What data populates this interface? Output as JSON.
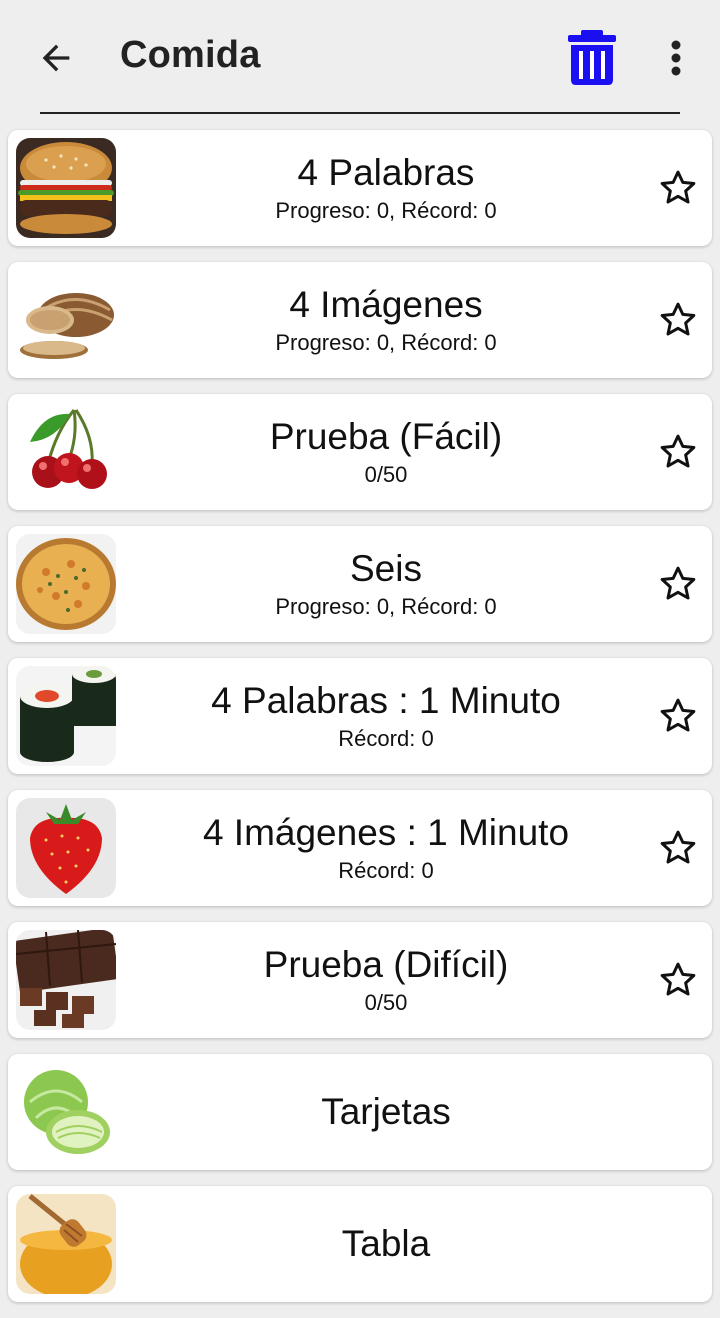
{
  "header": {
    "title": "Comida",
    "back_icon": "arrow-back-icon",
    "trash_icon": "trash-icon",
    "trash_color": "#1a0ff0",
    "more_icon": "more-vert-icon"
  },
  "items": [
    {
      "label": "4 Palabras",
      "sub": "Progreso: 0, Récord: 0",
      "image": "burger",
      "favorite": false
    },
    {
      "label": "4 Imágenes",
      "sub": "Progreso: 0, Récord: 0",
      "image": "bread",
      "favorite": false
    },
    {
      "label": "Prueba (Fácil)",
      "sub": "0/50",
      "image": "cherries",
      "favorite": false
    },
    {
      "label": "Seis",
      "sub": "Progreso: 0, Récord: 0",
      "image": "pizza",
      "favorite": false
    },
    {
      "label": "4 Palabras : 1 Minuto",
      "sub": "Récord: 0",
      "image": "sushi",
      "favorite": false
    },
    {
      "label": "4 Imágenes : 1 Minuto",
      "sub": "Récord: 0",
      "image": "strawberry",
      "favorite": false
    },
    {
      "label": "Prueba (Difícil)",
      "sub": "0/50",
      "image": "chocolate",
      "favorite": false
    },
    {
      "label": "Tarjetas",
      "image": "cabbage"
    },
    {
      "label": "Tabla",
      "image": "honey"
    }
  ]
}
